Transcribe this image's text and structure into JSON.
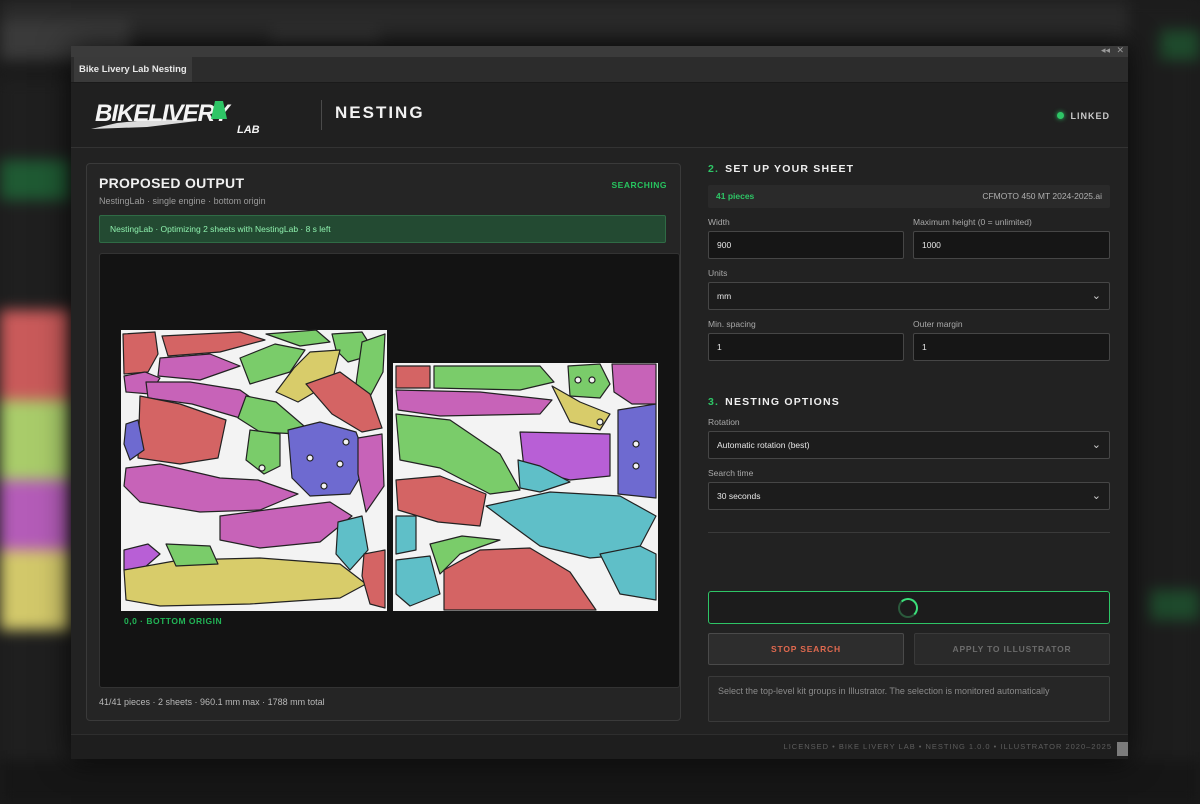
{
  "window": {
    "tab_label": "Bike Livery Lab   Nesting",
    "ctl_collapse": "◂◂",
    "ctl_close": "✕"
  },
  "header": {
    "logo_text": "BIKELIVERY",
    "logo_sub": "LAB",
    "title": "NESTING",
    "status": "LINKED"
  },
  "output": {
    "title": "PROPOSED OUTPUT",
    "subtitle": "NestingLab · single engine · bottom origin",
    "state": "SEARCHING",
    "message": "NestingLab · Optimizing 2 sheets with NestingLab · 8 s left",
    "origin_label": "0,0 · BOTTOM ORIGIN",
    "summary": "41/41 pieces · 2 sheets · 960.1 mm max · 1788 mm total"
  },
  "sheet": {
    "heading_num": "2.",
    "heading": "SET UP YOUR SHEET",
    "pieces_count": "41 pieces",
    "file_name": "CFMOTO 450 MT 2024-2025.ai",
    "width_label": "Width",
    "width_value": "900",
    "max_height_label": "Maximum height (0 = unlimited)",
    "max_height_value": "1000",
    "units_label": "Units",
    "units_value": "mm",
    "spacing_label": "Min. spacing",
    "spacing_value": "1",
    "margin_label": "Outer margin",
    "margin_value": "1"
  },
  "options": {
    "heading_num": "3.",
    "heading": "NESTING OPTIONS",
    "rotation_label": "Rotation",
    "rotation_value": "Automatic rotation (best)",
    "time_label": "Search time",
    "time_value": "30 seconds"
  },
  "actions": {
    "stop": "STOP SEARCH",
    "apply": "APPLY TO ILLUSTRATOR",
    "hint": "Select the top-level kit groups in Illustrator. The selection is monitored automatically"
  },
  "footer": {
    "text": "LICENSED  •  BIKE LIVERY LAB  •  NESTING 1.0.0  •  ILLUSTRATOR 2020–2025"
  },
  "colors": {
    "accent": "#2ec566",
    "stop": "#e0694f",
    "piece_red": "#d46464",
    "piece_green": "#7acc6a",
    "piece_yellow": "#d8cc6a",
    "piece_purple": "#6e6ad0",
    "piece_magenta": "#c763b8",
    "piece_teal": "#5fbfc8",
    "piece_violet": "#b85fd6"
  }
}
